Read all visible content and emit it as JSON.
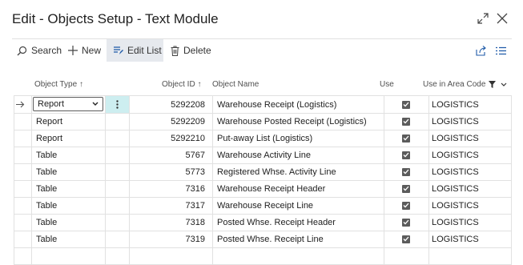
{
  "window": {
    "title": "Edit - Objects Setup - Text Module"
  },
  "toolbar": {
    "search_label": "Search",
    "new_label": "New",
    "edit_list_label": "Edit List",
    "delete_label": "Delete"
  },
  "table": {
    "headers": {
      "object_type": "Object Type ↑",
      "object_id": "Object ID ↑",
      "object_name": "Object Name",
      "use": "Use",
      "use_in_area_code": "Use in Area Code"
    },
    "rows": [
      {
        "type": "Report",
        "id": "5292208",
        "name": "Warehouse Receipt (Logistics)",
        "use": true,
        "area": "LOGISTICS"
      },
      {
        "type": "Report",
        "id": "5292209",
        "name": "Warehouse Posted Receipt (Logistics)",
        "use": true,
        "area": "LOGISTICS"
      },
      {
        "type": "Report",
        "id": "5292210",
        "name": "Put-away List (Logistics)",
        "use": true,
        "area": "LOGISTICS"
      },
      {
        "type": "Table",
        "id": "5767",
        "name": "Warehouse Activity Line",
        "use": true,
        "area": "LOGISTICS"
      },
      {
        "type": "Table",
        "id": "5773",
        "name": "Registered Whse. Activity Line",
        "use": true,
        "area": "LOGISTICS"
      },
      {
        "type": "Table",
        "id": "7316",
        "name": "Warehouse Receipt Header",
        "use": true,
        "area": "LOGISTICS"
      },
      {
        "type": "Table",
        "id": "7317",
        "name": "Warehouse Receipt Line",
        "use": true,
        "area": "LOGISTICS"
      },
      {
        "type": "Table",
        "id": "7318",
        "name": "Posted Whse. Receipt Header",
        "use": true,
        "area": "LOGISTICS"
      },
      {
        "type": "Table",
        "id": "7319",
        "name": "Posted Whse. Receipt Line",
        "use": true,
        "area": "LOGISTICS"
      }
    ]
  },
  "colors": {
    "accent": "#008489",
    "selected_cell": "#cdeef0",
    "text": "#212121",
    "grid": "#e1e1e1"
  }
}
